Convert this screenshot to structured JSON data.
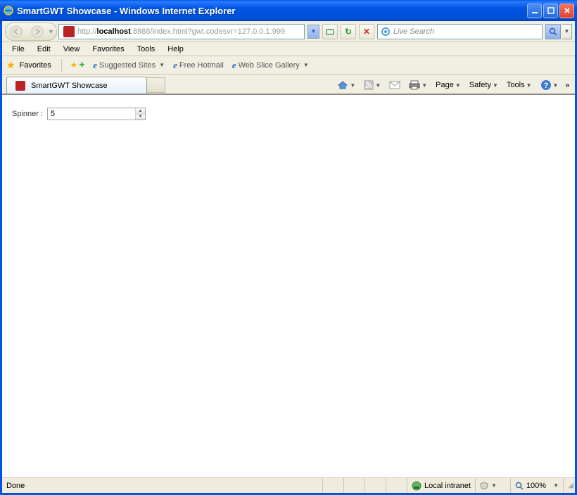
{
  "title": "SmartGWT Showcase - Windows Internet Explorer",
  "window_buttons": {
    "min": "_",
    "max": "❐",
    "close": "✕"
  },
  "address": {
    "scheme": "http://",
    "host": "localhost",
    "rest": ":8888/index.html?gwt.codesvr=127.0.0.1:999"
  },
  "search": {
    "placeholder": "Live Search"
  },
  "menus": [
    "File",
    "Edit",
    "View",
    "Favorites",
    "Tools",
    "Help"
  ],
  "favorites": {
    "label": "Favorites",
    "links": [
      "Suggested Sites",
      "Free Hotmail",
      "Web Slice Gallery"
    ]
  },
  "tab": {
    "title": "SmartGWT Showcase"
  },
  "commandbar": {
    "page": "Page",
    "safety": "Safety",
    "tools": "Tools"
  },
  "form": {
    "spinner_label": "Spinner :",
    "spinner_value": "5"
  },
  "status": {
    "done": "Done",
    "zone": "Local intranet",
    "zoom": "100%"
  }
}
